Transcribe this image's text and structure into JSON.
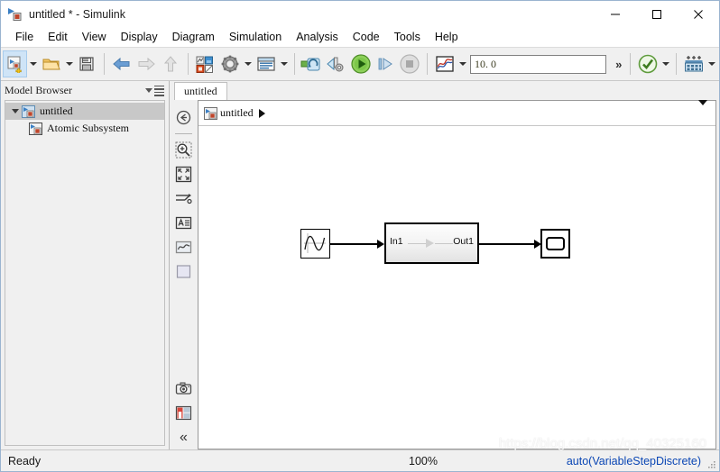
{
  "window": {
    "title": "untitled * - Simulink",
    "icon": "simulink-model-icon",
    "controls": [
      {
        "name": "minimize-button",
        "glyph": "—"
      },
      {
        "name": "maximize-button",
        "glyph": "□"
      },
      {
        "name": "close-button",
        "glyph": "✕"
      }
    ]
  },
  "menubar": {
    "items": [
      {
        "label": "File"
      },
      {
        "label": "Edit"
      },
      {
        "label": "View"
      },
      {
        "label": "Display"
      },
      {
        "label": "Diagram"
      },
      {
        "label": "Simulation"
      },
      {
        "label": "Analysis"
      },
      {
        "label": "Code"
      },
      {
        "label": "Tools"
      },
      {
        "label": "Help"
      }
    ]
  },
  "toolbar": {
    "new_model_icon": "new-model-icon",
    "open_icon": "open-folder-icon",
    "save_icon": "save-disk-icon",
    "back_icon": "back-arrow-icon",
    "forward_icon": "forward-arrow-icon",
    "up_icon": "up-arrow-icon",
    "library_icon": "library-browser-icon",
    "settings_icon": "model-configuration-gear-icon",
    "print_icon": "model-explorer-icon",
    "update_icon": "update-model-icon",
    "build_icon": "build-model-icon",
    "run_icon": "run-play-icon",
    "step_icon": "step-forward-icon",
    "stop_icon": "stop-icon",
    "scope_icon": "simulation-data-inspector-icon",
    "sim_time_value": "10. 0",
    "sim_time_placeholder": "10.0",
    "overflow_glyph": "»",
    "check_icon": "model-advisor-check-icon",
    "toolstrip_icon": "toolstrip-options-icon"
  },
  "browser": {
    "title": "Model Browser",
    "options_icon": "panel-options-icon",
    "tree": [
      {
        "label": "untitled",
        "icon": "simulink-model-icon",
        "selected": true,
        "expanded": true
      },
      {
        "label": "Atomic Subsystem",
        "icon": "subsystem-icon",
        "selected": false,
        "child": true
      }
    ]
  },
  "editor": {
    "tabs": [
      {
        "label": "untitled",
        "active": true
      }
    ],
    "breadcrumb": {
      "icon": "simulink-model-icon",
      "path": "untitled",
      "separator": "▶",
      "dropdown_icon": "chevron-down-icon"
    },
    "vertical_toolbar": [
      {
        "name": "navigate-back-icon"
      },
      {
        "name": "zoom-in-region-icon"
      },
      {
        "name": "fit-to-view-icon"
      },
      {
        "name": "signal-routing-icon"
      },
      {
        "name": "annotation-text-icon"
      },
      {
        "name": "scope-viewer-icon"
      },
      {
        "name": "area-block-icon"
      },
      {
        "name": "snapshot-camera-icon"
      },
      {
        "name": "layout-panels-icon"
      },
      {
        "name": "collapse-panel-icon",
        "glyph": "«"
      }
    ],
    "diagram": {
      "blocks": [
        {
          "name": "sine-wave-block",
          "type": "source",
          "label": ""
        },
        {
          "name": "atomic-subsystem-block",
          "type": "subsystem",
          "input_port_label": "In1",
          "output_port_label": "Out1"
        },
        {
          "name": "scope-block",
          "type": "sink",
          "label": ""
        }
      ]
    }
  },
  "statusbar": {
    "status": "Ready",
    "zoom": "100%",
    "solver": "auto(VariableStepDiscrete)",
    "resize_grip": "resize-grip-icon"
  },
  "watermark": {
    "text": "https://blog.csdn.net/qq_40325160"
  },
  "colors": {
    "accent": "#0a46b4",
    "selection": "#cfe4f7",
    "canvas": "#ffffff",
    "chrome": "#f0f0f0"
  }
}
